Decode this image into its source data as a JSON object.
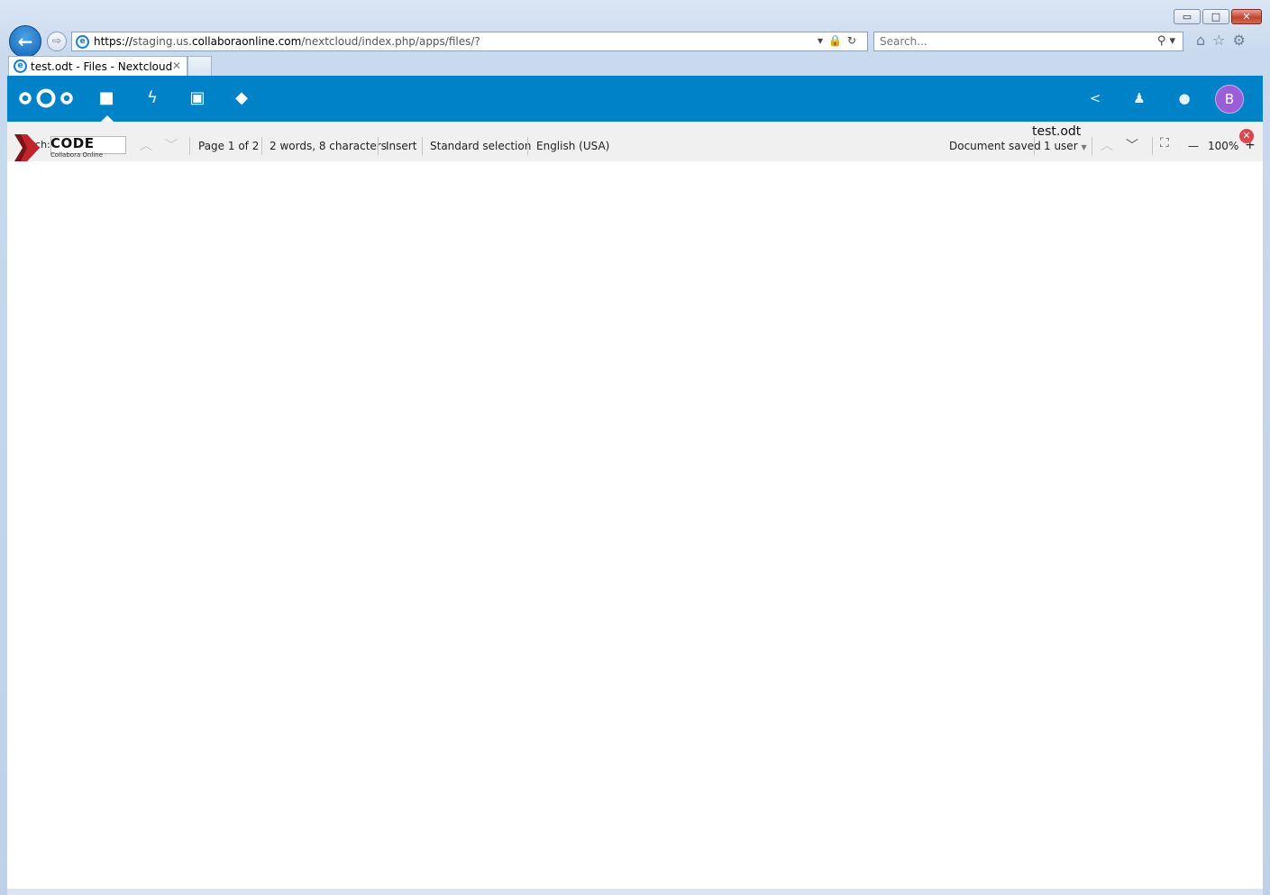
{
  "window": {
    "controls": {
      "minimize": "▭",
      "maximize": "□",
      "close": "✕"
    }
  },
  "browser": {
    "back_icon": "←",
    "forward_icon": "⇨",
    "address": {
      "scheme": "https://",
      "host_sub": "staging.us.",
      "host_main": "collaboraonline.com",
      "path": "/nextcloud/index.php/apps/files/?",
      "tools": "▾🔒↻"
    },
    "search": {
      "placeholder": "Search...",
      "icon": "⚲ ▾"
    },
    "toolbar_icons": "⌂☆⚙",
    "tab": {
      "title": "test.odt - Files - Nextcloud",
      "close": "✕"
    }
  },
  "nextcloud": {
    "apps": [
      {
        "name": "Files",
        "icon": "folder-icon",
        "glyph": "■"
      },
      {
        "name": "Activity",
        "icon": "bolt-icon",
        "glyph": "ϟ"
      },
      {
        "name": "Gallery",
        "icon": "image-icon",
        "glyph": "▣"
      },
      {
        "name": "Apps",
        "icon": "puzzle-icon",
        "glyph": "◆"
      }
    ],
    "right_icons": {
      "share": "<",
      "notifications": "♟",
      "contacts": "●"
    },
    "avatar_initial": "B",
    "colors": {
      "header": "#0082c9",
      "avatar": "#9a5fd8"
    }
  },
  "collabora": {
    "search_label": "arch:",
    "logo_title": "CODE",
    "logo_subtitle": "Collabora Online",
    "search_prev": "︿",
    "search_next": "﹀",
    "page_info": "Page 1 of 2",
    "word_count": "2 words, 8 characters",
    "insert_mode": "Insert",
    "selection_mode": "Standard selection",
    "language": "English (USA)",
    "document_title": "test.odt",
    "save_status": "Document saved",
    "users": "1 user",
    "users_caret": "▼",
    "nav_prev": "︿",
    "nav_next": "﹀",
    "fullscreen": "⛶",
    "zoom_out": "—",
    "zoom_level": "100%",
    "zoom_in": "+",
    "close_glyph": "✕",
    "colors": {
      "close": "#e0454b",
      "logo": "#c0262c"
    }
  }
}
